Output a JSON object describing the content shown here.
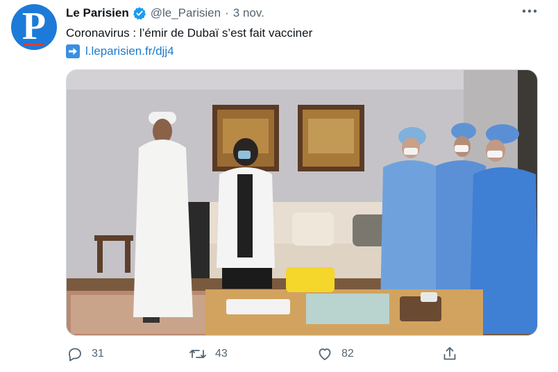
{
  "tweet": {
    "author_name": "Le Parisien",
    "handle": "@le_Parisien",
    "separator": "·",
    "date": "3 nov.",
    "text": "Coronavirus : l’émir de Dubaï s’est fait vacciner",
    "link": "l.leparisien.fr/djj4",
    "avatar_letter": "P"
  },
  "actions": {
    "replies": "31",
    "retweets": "43",
    "likes": "82"
  },
  "colors": {
    "brand": "#1d7ad8",
    "verified": "#1d9bf0",
    "link": "#1b7acc",
    "muted": "#536471"
  },
  "icons": [
    "verified-badge-icon",
    "more-icon",
    "link-arrow-icon",
    "reply-icon",
    "retweet-icon",
    "like-icon",
    "share-icon"
  ]
}
